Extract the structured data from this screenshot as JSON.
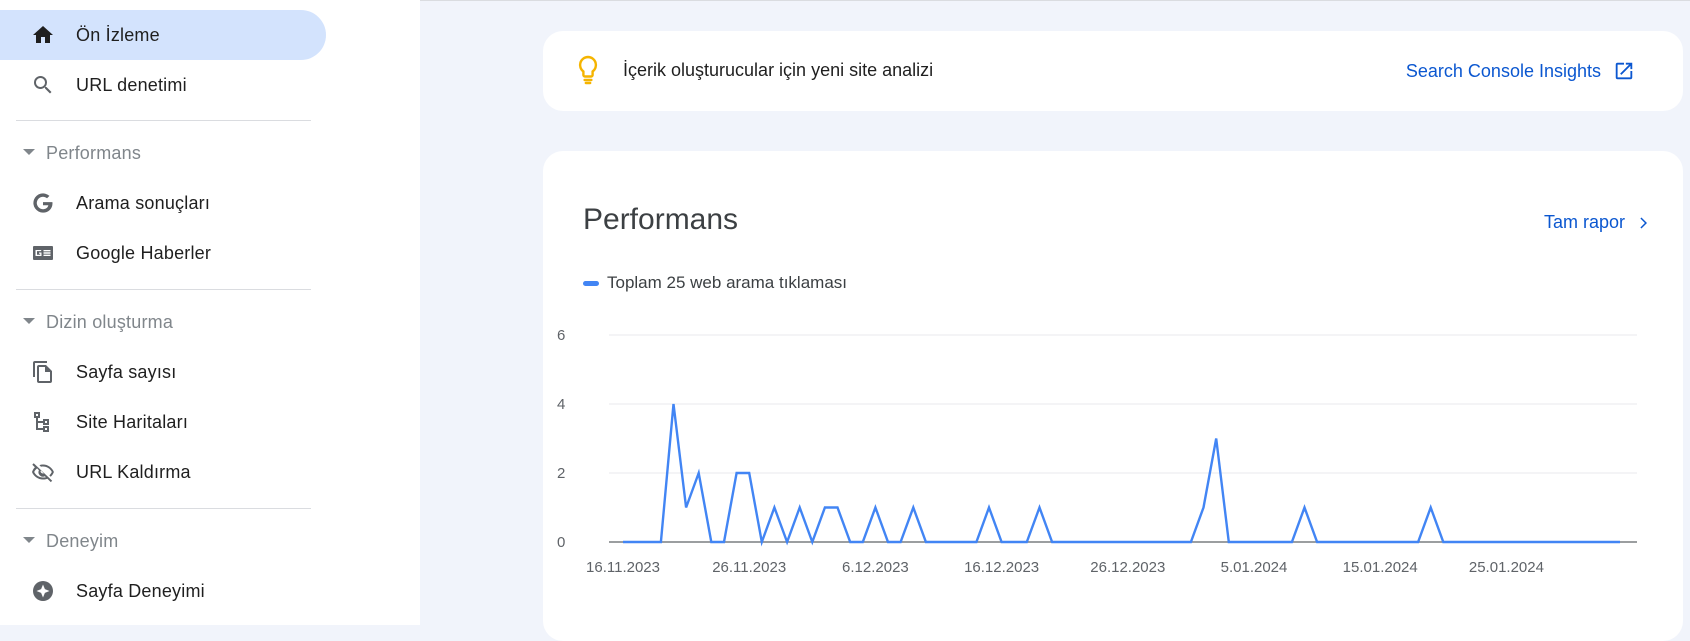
{
  "sidebar": {
    "items": [
      {
        "label": "Ön İzleme",
        "icon": "home-icon",
        "active": true
      },
      {
        "label": "URL denetimi",
        "icon": "search-icon"
      }
    ],
    "sections": [
      {
        "label": "Performans",
        "items": [
          {
            "label": "Arama sonuçları",
            "icon": "google-g-icon"
          },
          {
            "label": "Google Haberler",
            "icon": "news-icon"
          }
        ]
      },
      {
        "label": "Dizin oluşturma",
        "items": [
          {
            "label": "Sayfa sayısı",
            "icon": "pages-icon"
          },
          {
            "label": "Site Haritaları",
            "icon": "sitemap-icon"
          },
          {
            "label": "URL Kaldırma",
            "icon": "eye-off-icon"
          }
        ]
      },
      {
        "label": "Deneyim",
        "items": [
          {
            "label": "Sayfa Deneyimi",
            "icon": "page-experience-icon"
          }
        ]
      }
    ]
  },
  "insights": {
    "text": "İçerik oluşturucular için yeni site analizi",
    "link": "Search Console Insights",
    "icon": "lightbulb-icon"
  },
  "performance": {
    "title": "Performans",
    "report_link": "Tam rapor",
    "legend": "Toplam 25 web arama tıklaması"
  },
  "colors": {
    "accent": "#0b57d0",
    "active_bg": "#d3e3fd",
    "line": "#4285f4",
    "bulb": "#f5b400"
  },
  "chart_data": {
    "type": "line",
    "ylim": [
      0,
      6
    ],
    "yticks": [
      0,
      2,
      4,
      6
    ],
    "xlim": [
      "16.11.2023",
      "3.02.2024"
    ],
    "xtick_labels": [
      "16.11.2023",
      "26.11.2023",
      "6.12.2023",
      "16.12.2023",
      "26.12.2023",
      "5.01.2024",
      "15.01.2024",
      "25.01.2024"
    ],
    "series": [
      {
        "x": [
          "16.11.2023",
          "17.11.2023",
          "18.11.2023",
          "19.11.2023",
          "20.11.2023",
          "21.11.2023",
          "22.11.2023",
          "23.11.2023",
          "24.11.2023",
          "25.11.2023",
          "26.11.2023",
          "27.11.2023",
          "28.11.2023",
          "29.11.2023",
          "30.11.2023",
          "1.12.2023",
          "2.12.2023",
          "3.12.2023",
          "4.12.2023",
          "5.12.2023",
          "6.12.2023",
          "7.12.2023",
          "8.12.2023",
          "9.12.2023",
          "10.12.2023",
          "11.12.2023",
          "12.12.2023",
          "13.12.2023",
          "14.12.2023",
          "15.12.2023",
          "16.12.2023",
          "17.12.2023",
          "18.12.2023",
          "19.12.2023",
          "20.12.2023",
          "21.12.2023",
          "22.12.2023",
          "23.12.2023",
          "24.12.2023",
          "25.12.2023",
          "26.12.2023",
          "27.12.2023",
          "28.12.2023",
          "29.12.2023",
          "30.12.2023",
          "31.12.2023",
          "1.01.2024",
          "2.01.2024",
          "3.01.2024",
          "4.01.2024",
          "5.01.2024",
          "6.01.2024",
          "7.01.2024",
          "8.01.2024",
          "9.01.2024",
          "10.01.2024",
          "11.01.2024",
          "12.01.2024",
          "13.01.2024",
          "14.01.2024",
          "15.01.2024",
          "16.01.2024",
          "17.01.2024",
          "18.01.2024",
          "19.01.2024",
          "20.01.2024",
          "21.01.2024",
          "22.01.2024",
          "23.01.2024",
          "24.01.2024",
          "25.01.2024",
          "26.01.2024",
          "27.01.2024",
          "28.01.2024",
          "29.01.2024",
          "30.01.2024",
          "31.01.2024",
          "1.02.2024",
          "2.02.2024",
          "3.02.2024"
        ],
        "values": [
          0,
          0,
          0,
          0,
          4,
          1,
          2,
          0,
          0,
          2,
          2,
          0,
          1,
          0,
          1,
          0,
          1,
          1,
          0,
          0,
          1,
          0,
          0,
          1,
          0,
          0,
          0,
          0,
          0,
          1,
          0,
          0,
          0,
          1,
          0,
          0,
          0,
          0,
          0,
          0,
          0,
          0,
          0,
          0,
          0,
          0,
          1,
          3,
          0,
          0,
          0,
          0,
          0,
          0,
          1,
          0,
          0,
          0,
          0,
          0,
          0,
          0,
          0,
          0,
          1,
          0,
          0,
          0,
          0,
          0,
          0,
          0,
          0,
          0,
          0,
          0,
          0,
          0,
          0,
          0
        ]
      }
    ],
    "grid": true
  }
}
